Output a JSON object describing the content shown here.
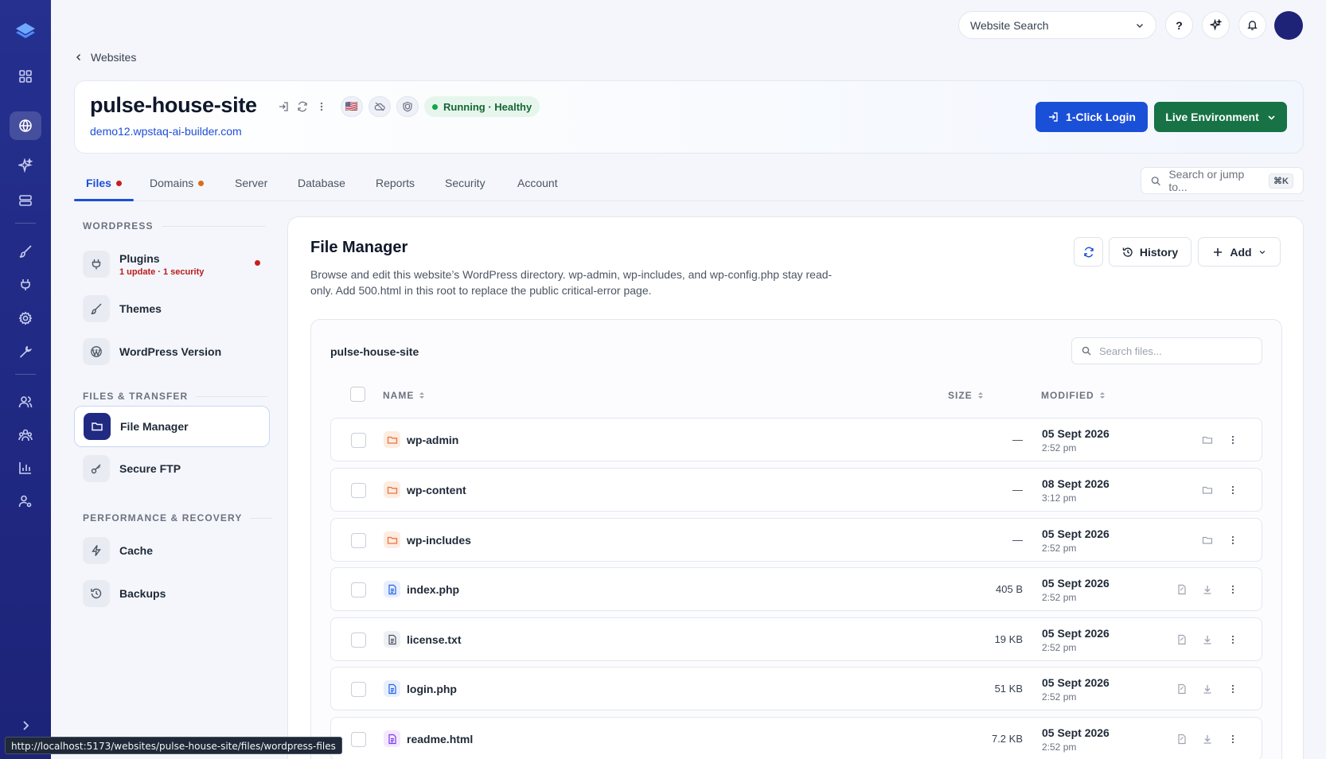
{
  "topbar": {
    "website_search": "Website Search",
    "help_label": "?"
  },
  "breadcrumb": {
    "label": "Websites"
  },
  "site": {
    "name": "pulse-house-site",
    "url": "demo12.wpstaq-ai-builder.com",
    "flag": "🇺🇸",
    "status": "Running · Healthy",
    "login_button": "1-Click Login",
    "env_button": "Live Environment"
  },
  "tabs": [
    {
      "label": "Files",
      "dot": true,
      "dot_color": "#c81e1e",
      "active": true
    },
    {
      "label": "Domains",
      "dot": true,
      "dot_color": "#dc6b19",
      "active": false
    },
    {
      "label": "Server",
      "active": false
    },
    {
      "label": "Database",
      "active": false
    },
    {
      "label": "Reports",
      "active": false
    },
    {
      "label": "Security",
      "active": false
    },
    {
      "label": "Account",
      "active": false
    }
  ],
  "jump": {
    "placeholder": "Search or jump to...",
    "shortcut": "⌘K"
  },
  "sidebar": {
    "sections": [
      {
        "title": "WORDPRESS"
      },
      {
        "title": "FILES & TRANSFER"
      },
      {
        "title": "PERFORMANCE & RECOVERY"
      }
    ],
    "items": [
      {
        "label": "Plugins",
        "sub": "1 update · 1 security",
        "icon": "plug-icon"
      },
      {
        "label": "Themes",
        "icon": "brush-icon"
      },
      {
        "label": "WordPress Version",
        "icon": "wordpress-icon"
      },
      {
        "label": "File Manager",
        "icon": "folder-icon",
        "active": true
      },
      {
        "label": "Secure FTP",
        "icon": "key-icon"
      },
      {
        "label": "Cache",
        "icon": "bolt-icon"
      },
      {
        "label": "Backups",
        "icon": "history-icon"
      }
    ]
  },
  "file_manager": {
    "title": "File Manager",
    "description": "Browse and edit this website’s WordPress directory. wp-admin, wp-includes, and wp-config.php stay read-only. Add 500.html in this root to replace the public critical-error page.",
    "history_button": "History",
    "add_button": "Add",
    "root": "pulse-house-site",
    "search_placeholder": "Search files...",
    "columns": {
      "name": "NAME",
      "size": "SIZE",
      "modified": "MODIFIED"
    },
    "files": [
      {
        "name": "wp-admin",
        "type": "folder",
        "size": "—",
        "date": "05 Sept 2026",
        "time": "2:52 pm"
      },
      {
        "name": "wp-content",
        "type": "folder",
        "size": "—",
        "date": "08 Sept 2026",
        "time": "3:12 pm"
      },
      {
        "name": "wp-includes",
        "type": "folder",
        "size": "—",
        "date": "05 Sept 2026",
        "time": "2:52 pm"
      },
      {
        "name": "index.php",
        "type": "php",
        "size": "405 B",
        "date": "05 Sept 2026",
        "time": "2:52 pm"
      },
      {
        "name": "license.txt",
        "type": "txt",
        "size": "19 KB",
        "date": "05 Sept 2026",
        "time": "2:52 pm"
      },
      {
        "name": "login.php",
        "type": "php",
        "size": "51 KB",
        "date": "05 Sept 2026",
        "time": "2:52 pm"
      },
      {
        "name": "readme.html",
        "type": "html",
        "size": "7.2 KB",
        "date": "05 Sept 2026",
        "time": "2:52 pm"
      }
    ]
  },
  "status_bar": {
    "url": "http://localhost:5173/websites/pulse-house-site/files/wordpress-files"
  },
  "colors": {
    "rail": "#25308f",
    "primary": "#1a4fd8",
    "live": "#177245",
    "healthy": "#16a34a",
    "folder": "#e8743b"
  }
}
